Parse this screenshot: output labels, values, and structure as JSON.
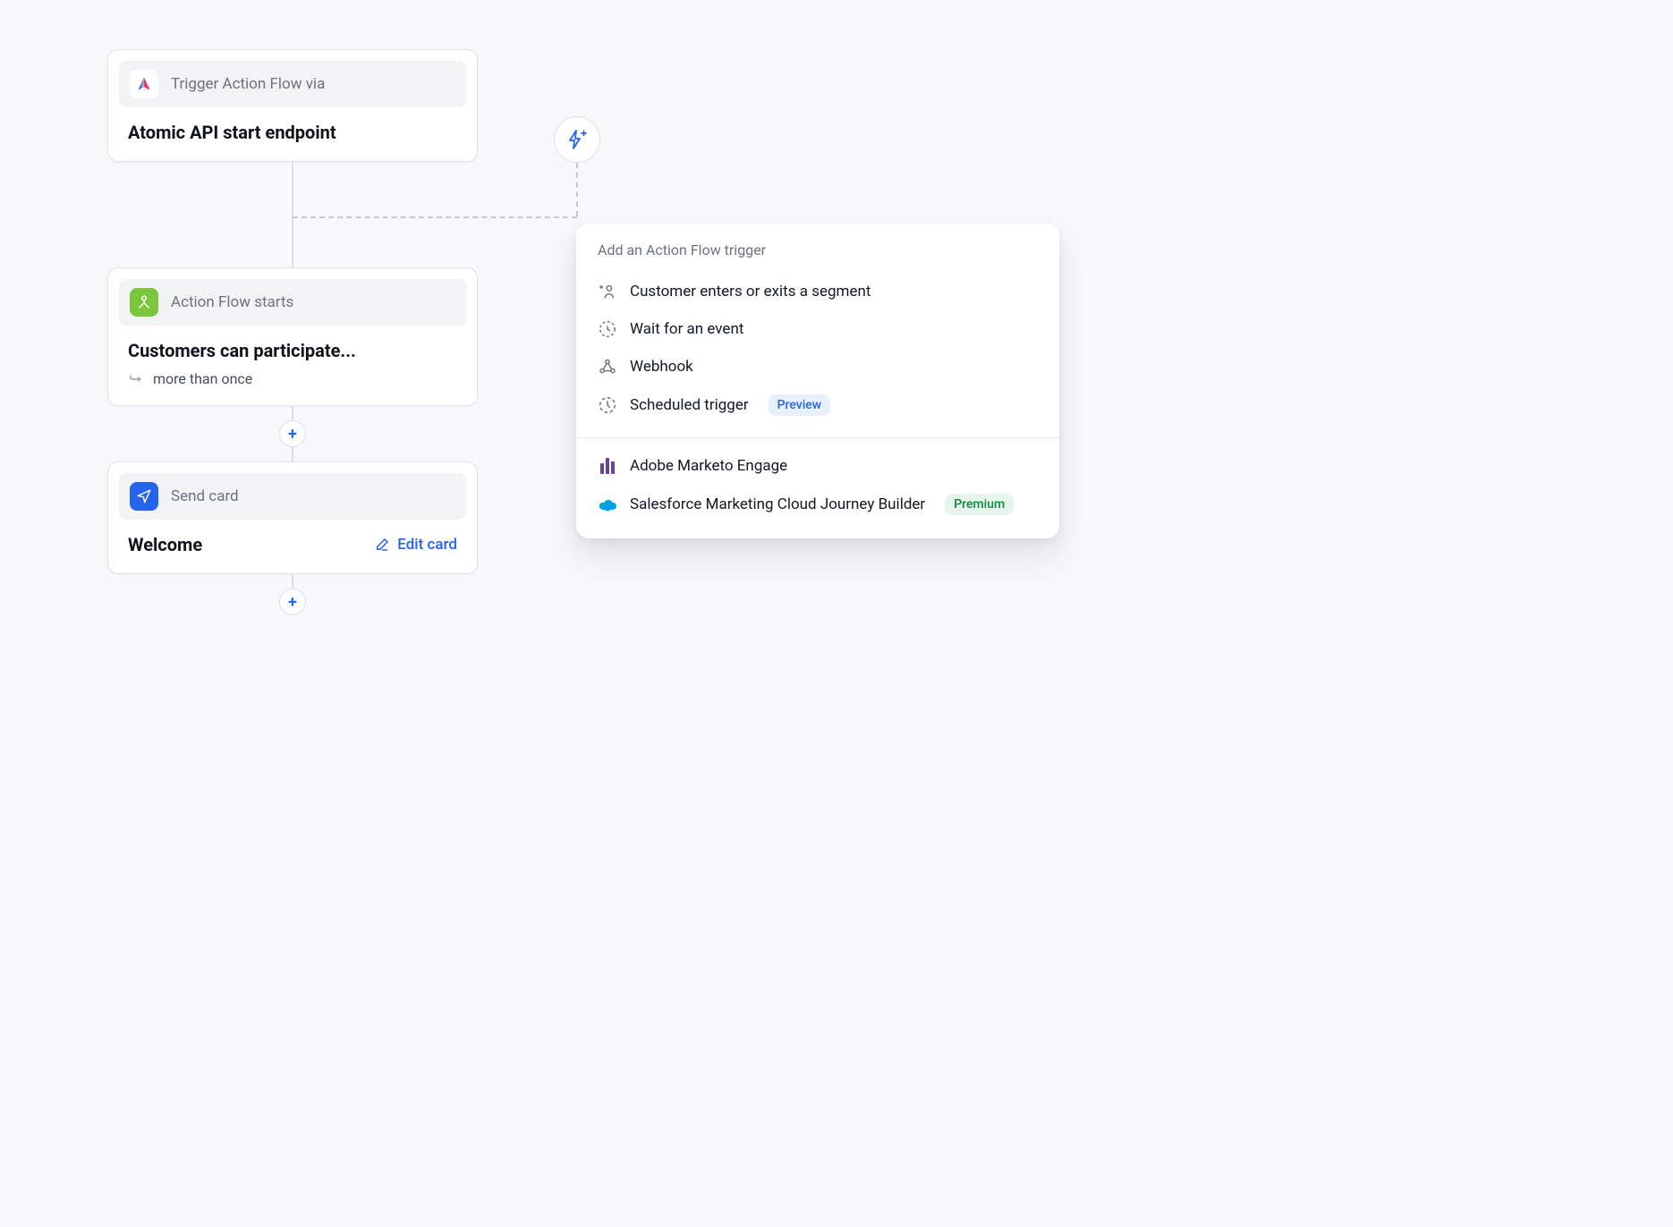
{
  "flow": {
    "node_trigger": {
      "header_label": "Trigger Action Flow via",
      "title": "Atomic API start endpoint"
    },
    "node_start": {
      "header_label": "Action Flow starts",
      "title": "Customers can participate...",
      "detail": "more than once"
    },
    "node_send": {
      "header_label": "Send card",
      "title": "Welcome",
      "edit_label": "Edit card"
    }
  },
  "popover": {
    "title": "Add an Action Flow trigger",
    "primary_items": [
      {
        "label": "Customer enters or exits a segment",
        "icon": "user-segment-icon"
      },
      {
        "label": "Wait for an event",
        "icon": "clock-dashed-icon"
      },
      {
        "label": "Webhook",
        "icon": "webhook-icon"
      },
      {
        "label": "Scheduled trigger",
        "icon": "schedule-icon",
        "badge": "Preview",
        "badge_type": "preview"
      }
    ],
    "integration_items": [
      {
        "label": "Adobe Marketo Engage",
        "icon": "marketo-icon"
      },
      {
        "label": "Salesforce Marketing Cloud Journey Builder",
        "icon": "salesforce-icon",
        "badge": "Premium",
        "badge_type": "premium"
      }
    ]
  }
}
